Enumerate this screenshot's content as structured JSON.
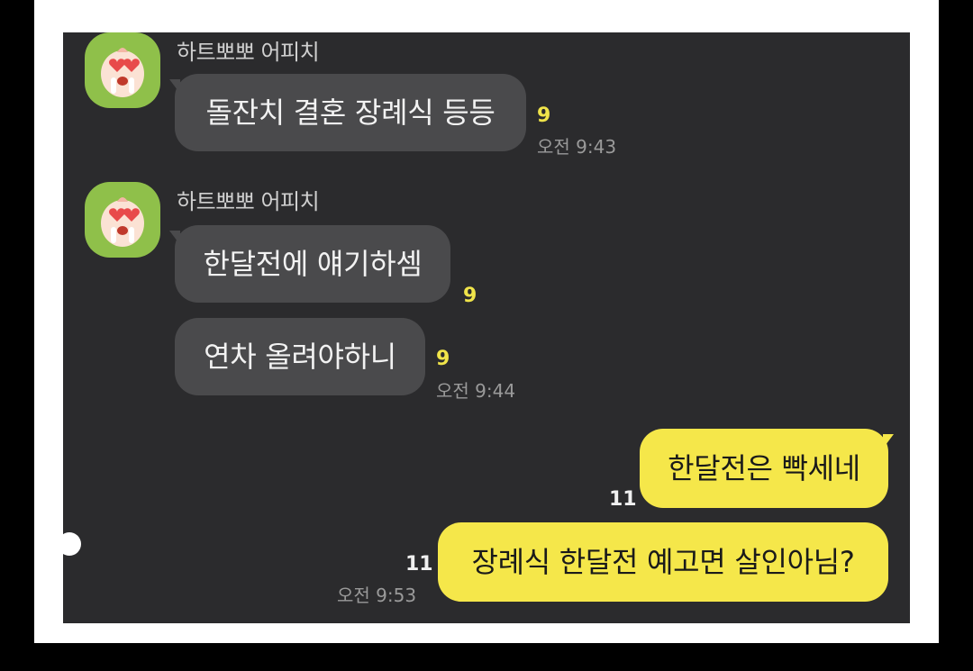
{
  "sender": {
    "name": "하트뽀뽀 어피치"
  },
  "messages": [
    {
      "text": "돌잔치 결혼 장례식 등등",
      "unread": "9",
      "time": "오전 9:43"
    },
    {
      "text": "한달전에 얘기하셈",
      "unread": "9"
    },
    {
      "text": "연차 올려야하니",
      "unread": "9",
      "time": "오전 9:44"
    },
    {
      "text": "한달전은 빡세네",
      "unread": "11"
    },
    {
      "text": "장례식 한달전 예고면 살인아님?",
      "unread": "11",
      "time": "오전 9:53"
    }
  ],
  "colors": {
    "panel": "#2b2b2d",
    "incoming_bubble": "#4a4a4c",
    "outgoing_bubble": "#f5e74a",
    "unread_count": "#f0e44a",
    "avatar": "#8fc04a"
  },
  "icons": {
    "avatar": "apeach-heart-eyes-icon"
  }
}
